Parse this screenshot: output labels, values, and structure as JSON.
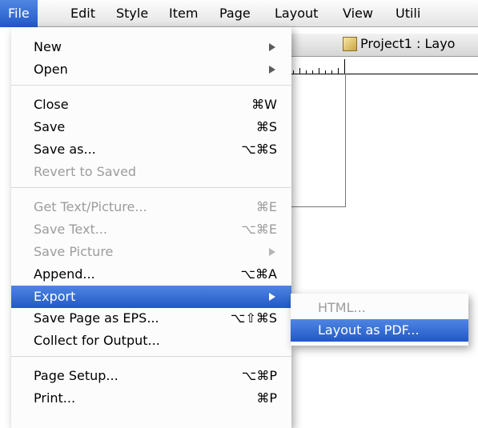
{
  "menubar": {
    "items": [
      {
        "label": "File",
        "active": true
      },
      {
        "label": "Edit"
      },
      {
        "label": "Style"
      },
      {
        "label": "Item"
      },
      {
        "label": "Page"
      },
      {
        "label": "Layout"
      },
      {
        "label": "View"
      },
      {
        "label": "Utili"
      }
    ]
  },
  "document": {
    "title": "Project1 : Layo",
    "title_icon": "document-icon"
  },
  "file_menu": {
    "items": [
      {
        "label": "New",
        "submenu": true
      },
      {
        "label": "Open",
        "submenu": true
      },
      {
        "label": "Close",
        "shortcut": "⌘W"
      },
      {
        "label": "Save",
        "shortcut": "⌘S"
      },
      {
        "label": "Save as...",
        "shortcut": "⌥⌘S"
      },
      {
        "label": "Revert to Saved",
        "disabled": true
      },
      {
        "label": "Get Text/Picture...",
        "shortcut": "⌘E",
        "disabled": true
      },
      {
        "label": "Save Text...",
        "shortcut": "⌥⌘E",
        "disabled": true
      },
      {
        "label": "Save Picture",
        "submenu": true,
        "disabled": true
      },
      {
        "label": "Append...",
        "shortcut": "⌥⌘A"
      },
      {
        "label": "Export",
        "submenu": true,
        "highlighted": true
      },
      {
        "label": "Save Page as EPS...",
        "shortcut": "⌥⇧⌘S"
      },
      {
        "label": "Collect for Output..."
      },
      {
        "label": "Page Setup...",
        "shortcut": "⌥⌘P"
      },
      {
        "label": "Print...",
        "shortcut": "⌘P"
      }
    ]
  },
  "export_submenu": {
    "items": [
      {
        "label": "HTML...",
        "disabled": true
      },
      {
        "label": "Layout as PDF...",
        "highlighted": true
      }
    ]
  },
  "colors": {
    "highlight": "#2f6bd6",
    "disabled_text": "#9c9c9c"
  }
}
